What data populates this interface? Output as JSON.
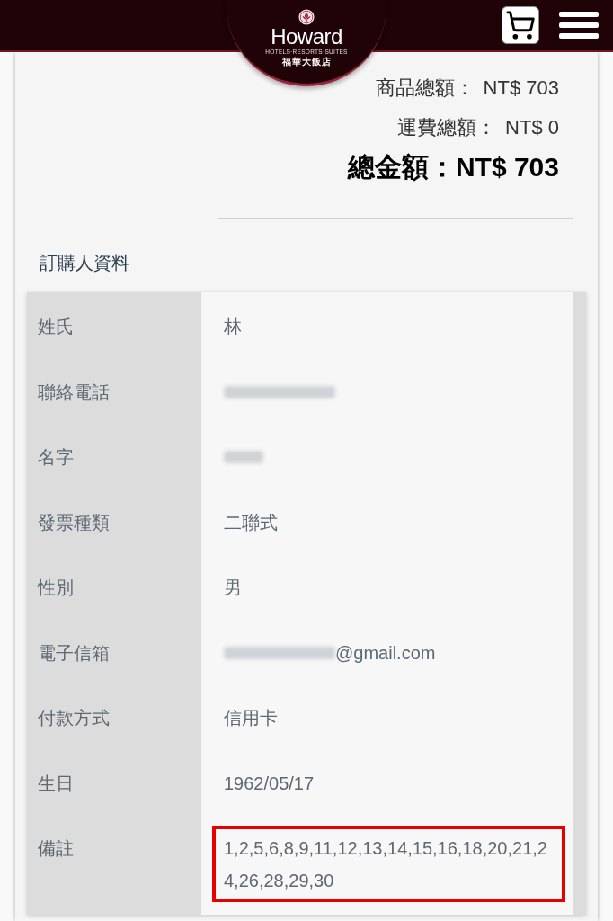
{
  "header": {
    "logo": {
      "name": "Howard",
      "tagline": "HOTELS·RESORTS·SUITES",
      "chinese_name": "福華大飯店"
    }
  },
  "summary": [
    {
      "kind": "subtotal",
      "label": "商品總額：",
      "amount": "NT$ 703"
    },
    {
      "kind": "subtotal",
      "label": "運費總額：",
      "amount": "NT$ 0"
    },
    {
      "kind": "total",
      "label": "總金額：",
      "amount": "NT$ 703"
    }
  ],
  "buyer_info": {
    "title": "訂購人資料",
    "rows": [
      {
        "label": "姓氏",
        "value": [
          {
            "kind": "text",
            "text": "林"
          }
        ],
        "highlighted": false
      },
      {
        "label": "聯絡電話",
        "value": [
          {
            "kind": "blurred_long"
          }
        ],
        "highlighted": false
      },
      {
        "label": "名字",
        "value": [
          {
            "kind": "blurred_short"
          }
        ],
        "highlighted": false
      },
      {
        "label": "發票種類",
        "value": [
          {
            "kind": "text",
            "text": "二聯式"
          }
        ],
        "highlighted": false
      },
      {
        "label": "性別",
        "value": [
          {
            "kind": "text",
            "text": "男"
          }
        ],
        "highlighted": false
      },
      {
        "label": "電子信箱",
        "value": [
          {
            "kind": "blurred_long"
          },
          {
            "kind": "text",
            "text": "@gmail.com"
          }
        ],
        "highlighted": false
      },
      {
        "label": "付款方式",
        "value": [
          {
            "kind": "text",
            "text": "信用卡"
          }
        ],
        "highlighted": false
      },
      {
        "label": "生日",
        "value": [
          {
            "kind": "text",
            "text": "1962/05/17"
          }
        ],
        "highlighted": false
      },
      {
        "label": "備註",
        "value": [
          {
            "kind": "text",
            "text": "1,2,5,6,8,9,11,12,13,14,15,16,18,20,21,24,26,28,29,30"
          }
        ],
        "highlighted": true
      }
    ]
  }
}
